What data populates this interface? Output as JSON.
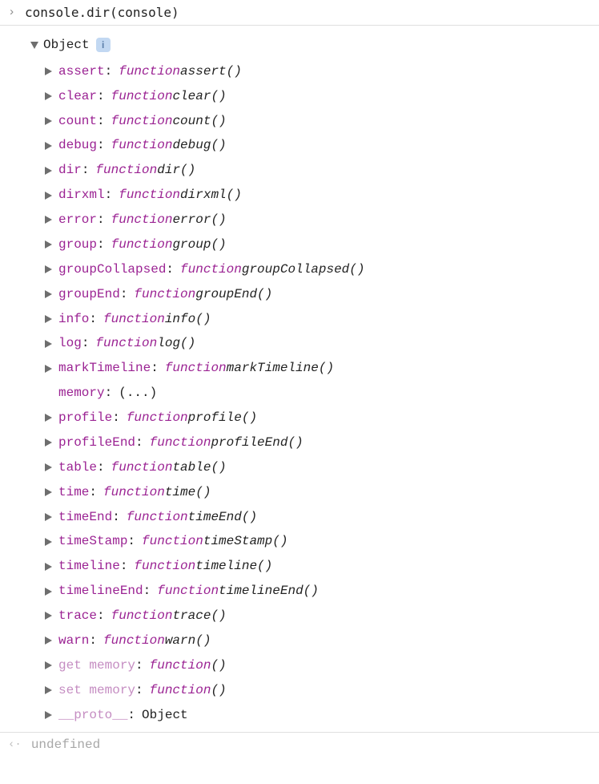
{
  "input": {
    "prompt": "›",
    "command": "console.dir(console)"
  },
  "output": {
    "root_label": "Object",
    "info_badge": "i",
    "info_badge_title": "Object state below is captured upon first expansion",
    "props": [
      {
        "key": "assert",
        "keyStyle": "normal",
        "valueType": "func",
        "funcName": "assert()",
        "hasArrow": true
      },
      {
        "key": "clear",
        "keyStyle": "normal",
        "valueType": "func",
        "funcName": "clear()",
        "hasArrow": true
      },
      {
        "key": "count",
        "keyStyle": "normal",
        "valueType": "func",
        "funcName": "count()",
        "hasArrow": true
      },
      {
        "key": "debug",
        "keyStyle": "normal",
        "valueType": "func",
        "funcName": "debug()",
        "hasArrow": true
      },
      {
        "key": "dir",
        "keyStyle": "normal",
        "valueType": "func",
        "funcName": "dir()",
        "hasArrow": true
      },
      {
        "key": "dirxml",
        "keyStyle": "normal",
        "valueType": "func",
        "funcName": "dirxml()",
        "hasArrow": true
      },
      {
        "key": "error",
        "keyStyle": "normal",
        "valueType": "func",
        "funcName": "error()",
        "hasArrow": true
      },
      {
        "key": "group",
        "keyStyle": "normal",
        "valueType": "func",
        "funcName": "group()",
        "hasArrow": true
      },
      {
        "key": "groupCollapsed",
        "keyStyle": "normal",
        "valueType": "func",
        "funcName": "groupCollapsed()",
        "hasArrow": true
      },
      {
        "key": "groupEnd",
        "keyStyle": "normal",
        "valueType": "func",
        "funcName": "groupEnd()",
        "hasArrow": true
      },
      {
        "key": "info",
        "keyStyle": "normal",
        "valueType": "func",
        "funcName": "info()",
        "hasArrow": true
      },
      {
        "key": "log",
        "keyStyle": "normal",
        "valueType": "func",
        "funcName": "log()",
        "hasArrow": true
      },
      {
        "key": "markTimeline",
        "keyStyle": "normal",
        "valueType": "func",
        "funcName": "markTimeline()",
        "hasArrow": true
      },
      {
        "key": "memory",
        "keyStyle": "normal",
        "valueType": "plain",
        "plainValue": "(...)",
        "hasArrow": false
      },
      {
        "key": "profile",
        "keyStyle": "normal",
        "valueType": "func",
        "funcName": "profile()",
        "hasArrow": true
      },
      {
        "key": "profileEnd",
        "keyStyle": "normal",
        "valueType": "func",
        "funcName": "profileEnd()",
        "hasArrow": true
      },
      {
        "key": "table",
        "keyStyle": "normal",
        "valueType": "func",
        "funcName": "table()",
        "hasArrow": true
      },
      {
        "key": "time",
        "keyStyle": "normal",
        "valueType": "func",
        "funcName": "time()",
        "hasArrow": true
      },
      {
        "key": "timeEnd",
        "keyStyle": "normal",
        "valueType": "func",
        "funcName": "timeEnd()",
        "hasArrow": true
      },
      {
        "key": "timeStamp",
        "keyStyle": "normal",
        "valueType": "func",
        "funcName": "timeStamp()",
        "hasArrow": true
      },
      {
        "key": "timeline",
        "keyStyle": "normal",
        "valueType": "func",
        "funcName": "timeline()",
        "hasArrow": true
      },
      {
        "key": "timelineEnd",
        "keyStyle": "normal",
        "valueType": "func",
        "funcName": "timelineEnd()",
        "hasArrow": true
      },
      {
        "key": "trace",
        "keyStyle": "normal",
        "valueType": "func",
        "funcName": "trace()",
        "hasArrow": true
      },
      {
        "key": "warn",
        "keyStyle": "normal",
        "valueType": "func",
        "funcName": "warn()",
        "hasArrow": true
      },
      {
        "key": "get memory",
        "keyStyle": "faded",
        "valueType": "func",
        "funcName": "()",
        "hasArrow": true
      },
      {
        "key": "set memory",
        "keyStyle": "faded",
        "valueType": "func",
        "funcName": "()",
        "hasArrow": true
      },
      {
        "key": "__proto__",
        "keyStyle": "faded",
        "valueType": "plain",
        "plainValue": "Object",
        "hasArrow": true
      }
    ]
  },
  "result": {
    "prompt": "‹·",
    "value": "undefined"
  },
  "function_keyword": "function"
}
